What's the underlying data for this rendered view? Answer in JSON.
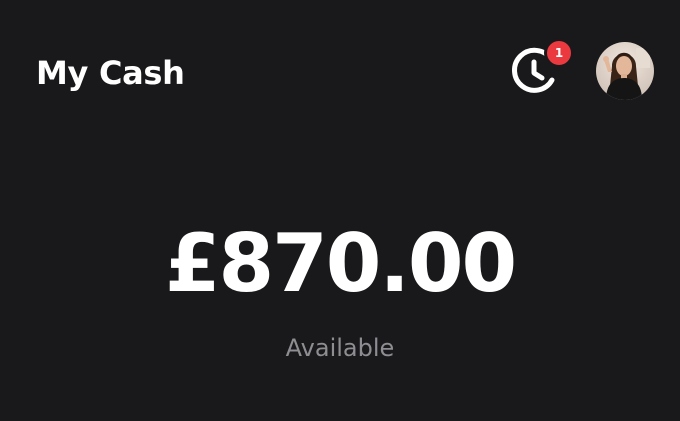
{
  "header": {
    "title": "My Cash",
    "activity_icon": "clock-icon",
    "notification_count": "1",
    "avatar_icon": "profile-avatar"
  },
  "balance": {
    "amount": "£870.00",
    "label": "Available"
  },
  "colors": {
    "background": "#19191b",
    "text_primary": "#ffffff",
    "text_secondary": "#8d8d92",
    "badge": "#ea3a3f"
  }
}
